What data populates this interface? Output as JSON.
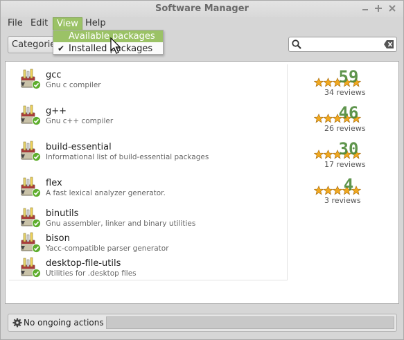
{
  "window": {
    "title": "Software Manager",
    "controls": [
      "minimize",
      "maximize",
      "close"
    ]
  },
  "menubar": {
    "items": [
      {
        "label": "File",
        "active": false
      },
      {
        "label": "Edit",
        "active": false
      },
      {
        "label": "View",
        "active": true
      },
      {
        "label": "Help",
        "active": false
      }
    ]
  },
  "view_menu": {
    "items": [
      {
        "label": "Available packages",
        "checked": false,
        "hovered": true
      },
      {
        "label": "Installed packages",
        "checked": true,
        "hovered": false
      }
    ]
  },
  "toolbar": {
    "categories_label": "Categories",
    "search": {
      "value": "",
      "placeholder": ""
    }
  },
  "packages": [
    {
      "name": "gcc",
      "description": "Gnu c compiler",
      "score": "59",
      "reviews": "34 reviews",
      "stars": 5,
      "installed": true
    },
    {
      "name": "g++",
      "description": "Gnu c++ compiler",
      "score": "46",
      "reviews": "26 reviews",
      "stars": 5,
      "installed": true
    },
    {
      "name": "build-essential",
      "description": "Informational list of build-essential packages",
      "score": "30",
      "reviews": "17 reviews",
      "stars": 5,
      "installed": true
    },
    {
      "name": "flex",
      "description": "A fast lexical analyzer generator.",
      "score": "4",
      "reviews": "3 reviews",
      "stars": 5,
      "installed": true
    },
    {
      "name": "binutils",
      "description": "Gnu assembler, linker and binary utilities",
      "score": "",
      "reviews": "",
      "stars": 0,
      "installed": true
    },
    {
      "name": "bison",
      "description": "Yacc-compatible parser generator",
      "score": "",
      "reviews": "",
      "stars": 0,
      "installed": true
    },
    {
      "name": "desktop-file-utils",
      "description": "Utilities for .desktop files",
      "score": "",
      "reviews": "",
      "stars": 0,
      "installed": true
    }
  ],
  "statusbar": {
    "text": "No ongoing actions",
    "progress": 0
  },
  "colors": {
    "accent": "#9bc266",
    "star": "#f0a820",
    "score": "#4e8a3a",
    "installed_badge": "#5fae2e"
  }
}
